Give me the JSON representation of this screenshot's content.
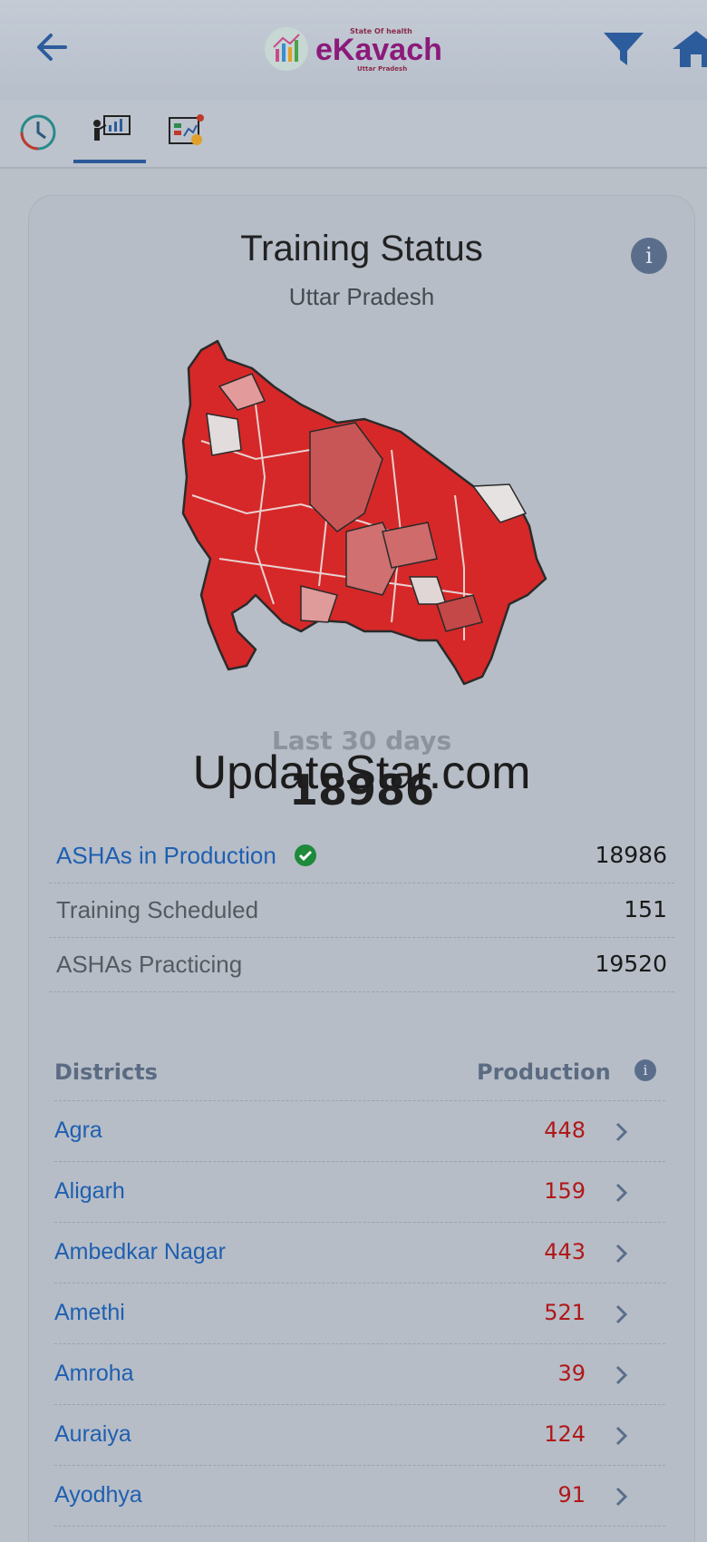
{
  "header": {
    "logo_tag": "State Of health",
    "logo_name": "eKavach",
    "logo_sub": "Uttar Pradesh",
    "icons": [
      "back-arrow-icon",
      "filter-icon",
      "home-icon"
    ]
  },
  "tabs": [
    {
      "icon": "clock-icon",
      "active": false
    },
    {
      "icon": "training-board-icon",
      "active": true
    },
    {
      "icon": "analytics-icon",
      "active": false
    }
  ],
  "card": {
    "title": "Training Status",
    "subtitle": "Uttar Pradesh",
    "info": "i",
    "period_label": "Last 30 days",
    "total": "18986",
    "watermark": "UpdateStar.com"
  },
  "stats": [
    {
      "label": "ASHAs in Production",
      "value": "18986"
    },
    {
      "label": "Training Scheduled",
      "value": "151"
    },
    {
      "label": "ASHAs Practicing",
      "value": "19520"
    }
  ],
  "districts": {
    "col_name": "Districts",
    "col_value": "Production",
    "info": "i",
    "rows": [
      {
        "name": "Agra",
        "value": "448"
      },
      {
        "name": "Aligarh",
        "value": "159"
      },
      {
        "name": "Ambedkar Nagar",
        "value": "443"
      },
      {
        "name": "Amethi",
        "value": "521"
      },
      {
        "name": "Amroha",
        "value": "39"
      },
      {
        "name": "Auraiya",
        "value": "124"
      },
      {
        "name": "Ayodhya",
        "value": "91"
      }
    ]
  },
  "colors": {
    "accent_blue": "#1f5fb0",
    "value_red": "#b01818",
    "map_red": "#d62828",
    "map_light": "#e29a9a"
  }
}
